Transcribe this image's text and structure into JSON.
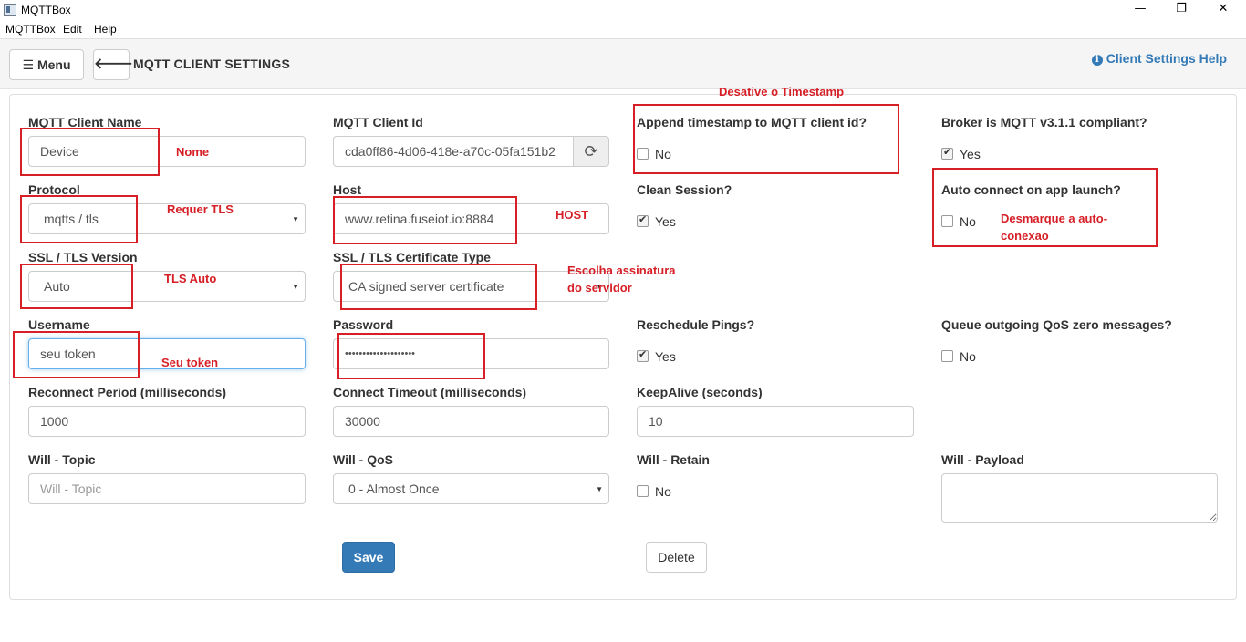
{
  "window": {
    "title": "MQTTBox",
    "controls": {
      "minimize": "—",
      "maximize": "❐",
      "close": "✕"
    }
  },
  "menubar": {
    "items": [
      "MQTTBox",
      "Edit",
      "Help"
    ]
  },
  "header": {
    "menu_icon": "hamburger-icon",
    "menu_label": "☰ Menu",
    "back_icon": "arrow-left-icon",
    "back_glyph": "🡐",
    "title": "MQTT CLIENT SETTINGS",
    "help_icon": "info-circle-icon",
    "help_label": "Client Settings Help"
  },
  "form": {
    "client_name": {
      "label": "MQTT Client Name",
      "value": "Device"
    },
    "client_id": {
      "label": "MQTT Client Id",
      "value": "cda0ff86-4d06-418e-a70c-05fa151b2",
      "refresh_icon": "refresh-icon"
    },
    "append_timestamp": {
      "label": "Append timestamp to MQTT client id?",
      "option": "No",
      "checked": false
    },
    "broker_compliant": {
      "label": "Broker is MQTT v3.1.1 compliant?",
      "option": "Yes",
      "checked": true
    },
    "protocol": {
      "label": "Protocol",
      "value": "mqtts / tls"
    },
    "host": {
      "label": "Host",
      "value": "www.retina.fuseiot.io:8884"
    },
    "clean_session": {
      "label": "Clean Session?",
      "option": "Yes",
      "checked": true
    },
    "auto_connect": {
      "label": "Auto connect on app launch?",
      "option": "No",
      "checked": false
    },
    "ssl_version": {
      "label": "SSL / TLS Version",
      "value": "Auto"
    },
    "cert_type": {
      "label": "SSL / TLS Certificate Type",
      "value": "CA signed server certificate"
    },
    "username": {
      "label": "Username",
      "value": "seu token"
    },
    "password": {
      "label": "Password",
      "value": "••••••••••••••••••••"
    },
    "reschedule_pings": {
      "label": "Reschedule Pings?",
      "option": "Yes",
      "checked": true
    },
    "queue_qos_zero": {
      "label": "Queue outgoing QoS zero messages?",
      "option": "No",
      "checked": false
    },
    "reconnect_period": {
      "label": "Reconnect Period (milliseconds)",
      "value": "1000"
    },
    "connect_timeout": {
      "label": "Connect Timeout (milliseconds)",
      "value": "30000"
    },
    "keepalive": {
      "label": "KeepAlive (seconds)",
      "value": "10"
    },
    "will_topic": {
      "label": "Will - Topic",
      "placeholder": "Will - Topic"
    },
    "will_qos": {
      "label": "Will - QoS",
      "value": "0 - Almost Once"
    },
    "will_retain": {
      "label": "Will - Retain",
      "option": "No",
      "checked": false
    },
    "will_payload": {
      "label": "Will - Payload",
      "value": ""
    },
    "save_label": "Save",
    "delete_label": "Delete"
  },
  "annotations": {
    "color": "#d61f26",
    "disable_timestamp": "Desative o Timestamp",
    "name": "Nome",
    "requires_tls": "Requer TLS",
    "host": "HOST",
    "uncheck_autoconnect_line1": "Desmarque a auto-",
    "uncheck_autoconnect_line2": "conexao",
    "tls_auto": "TLS Auto",
    "choose_signature_line1": "Escolha assinatura",
    "choose_signature_line2": "do servidor",
    "your_token": "Seu token"
  },
  "colors": {
    "primary": "#337ab7",
    "help_link": "#337ab7",
    "annotation": "#d61f26"
  }
}
